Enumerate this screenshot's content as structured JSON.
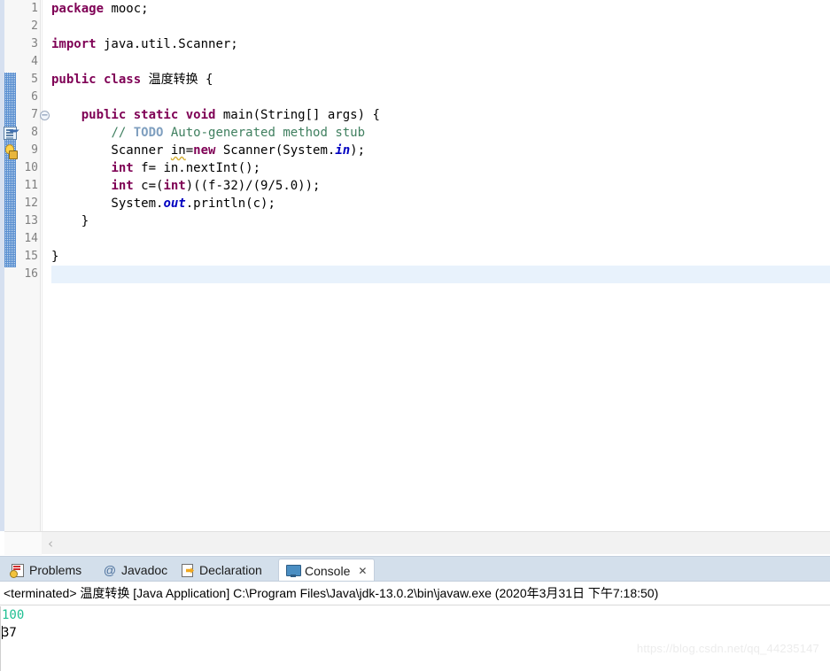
{
  "editor": {
    "language": "java",
    "current_line": 16,
    "lines": [
      {
        "n": 1,
        "segments": [
          {
            "t": "package",
            "c": "kw"
          },
          {
            "t": " mooc;",
            "c": "plain"
          }
        ]
      },
      {
        "n": 2,
        "segments": []
      },
      {
        "n": 3,
        "segments": [
          {
            "t": "import",
            "c": "kw"
          },
          {
            "t": " java.util.Scanner;",
            "c": "plain"
          }
        ]
      },
      {
        "n": 4,
        "segments": []
      },
      {
        "n": 5,
        "segments": [
          {
            "t": "public class",
            "c": "kw"
          },
          {
            "t": " 温度转换 {",
            "c": "plain"
          }
        ]
      },
      {
        "n": 6,
        "segments": []
      },
      {
        "n": 7,
        "fold": true,
        "segments": [
          {
            "t": "    ",
            "c": "plain"
          },
          {
            "t": "public static void",
            "c": "kw"
          },
          {
            "t": " main(String[] args) {",
            "c": "plain"
          }
        ]
      },
      {
        "n": 8,
        "marker": "todo-marker",
        "segments": [
          {
            "t": "        ",
            "c": "plain"
          },
          {
            "t": "// ",
            "c": "cmt"
          },
          {
            "t": "TODO",
            "c": "todo"
          },
          {
            "t": " Auto-generated method stub",
            "c": "cmt"
          }
        ]
      },
      {
        "n": 9,
        "marker": "warning-marker",
        "segments": [
          {
            "t": "        Scanner ",
            "c": "plain"
          },
          {
            "t": "in",
            "c": "warnu"
          },
          {
            "t": "=",
            "c": "plain"
          },
          {
            "t": "new",
            "c": "kw"
          },
          {
            "t": " Scanner(System.",
            "c": "plain"
          },
          {
            "t": "in",
            "c": "fld"
          },
          {
            "t": ");",
            "c": "plain"
          }
        ]
      },
      {
        "n": 10,
        "segments": [
          {
            "t": "        ",
            "c": "plain"
          },
          {
            "t": "int",
            "c": "kw"
          },
          {
            "t": " f= in.nextInt();",
            "c": "plain"
          }
        ]
      },
      {
        "n": 11,
        "segments": [
          {
            "t": "        ",
            "c": "plain"
          },
          {
            "t": "int",
            "c": "kw"
          },
          {
            "t": " c=(",
            "c": "plain"
          },
          {
            "t": "int",
            "c": "kw"
          },
          {
            "t": ")((f-32)/(9/5.0));",
            "c": "plain"
          }
        ]
      },
      {
        "n": 12,
        "segments": [
          {
            "t": "        System.",
            "c": "plain"
          },
          {
            "t": "out",
            "c": "fld"
          },
          {
            "t": ".println(c);",
            "c": "plain"
          }
        ]
      },
      {
        "n": 13,
        "segments": [
          {
            "t": "    }",
            "c": "plain"
          }
        ]
      },
      {
        "n": 14,
        "segments": []
      },
      {
        "n": 15,
        "segments": [
          {
            "t": "}",
            "c": "plain"
          }
        ]
      },
      {
        "n": 16,
        "segments": []
      }
    ],
    "scroll": {
      "left_arrow": "‹"
    }
  },
  "bottom_panel": {
    "tabs": [
      {
        "label": "Problems",
        "icon": "problems-icon",
        "active": false,
        "closeable": false
      },
      {
        "label": "Javadoc",
        "icon": "javadoc-at-icon",
        "active": false,
        "closeable": false
      },
      {
        "label": "Declaration",
        "icon": "declaration-icon",
        "active": false,
        "closeable": false
      },
      {
        "label": "Console",
        "icon": "console-icon",
        "active": true,
        "closeable": true,
        "close_glyph": "✕"
      }
    ],
    "console": {
      "header": "<terminated> 温度转换 [Java Application] C:\\Program Files\\Java\\jdk-13.0.2\\bin\\javaw.exe (2020年3月31日 下午7:18:50)",
      "output": [
        {
          "text": "100",
          "kind": "input-echo",
          "color": "#1fbf92"
        },
        {
          "text": "37",
          "kind": "std-out",
          "color": "#000000",
          "caret": true
        }
      ]
    }
  },
  "watermark": {
    "text": "https://blog.csdn.net/qq_44235147"
  },
  "colors": {
    "keyword": "#7f0055",
    "comment": "#3f7f5f",
    "todo_tag": "#7f9fbf",
    "static_field": "#0000c0",
    "current_line_bg": "#e8f2fc",
    "tabbar_bg": "#d3dfeb",
    "gutter_bg": "#f7f7f7",
    "annotation_bar": "#5a8fd0",
    "console_input": "#1fbf92"
  }
}
